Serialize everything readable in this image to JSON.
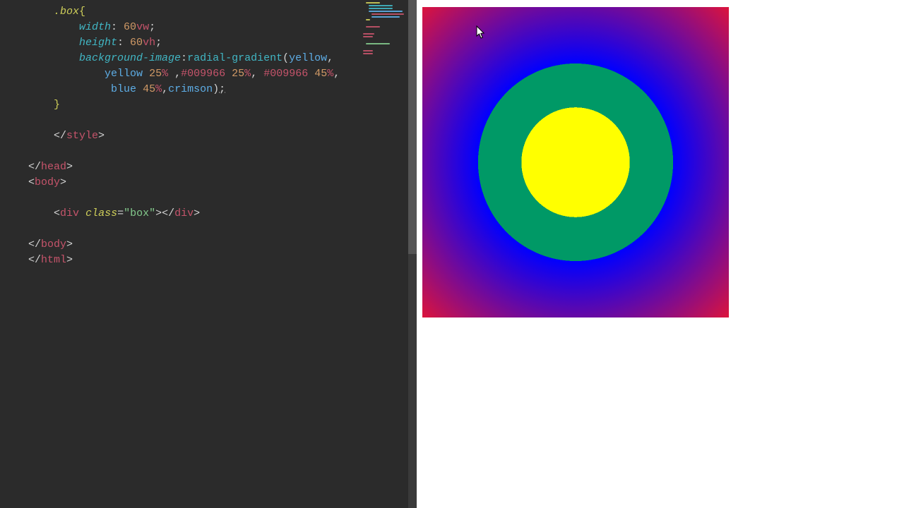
{
  "code": {
    "selector": ".box",
    "open_brace": "{",
    "width_prop": "width",
    "width_num": "60",
    "width_unit": "vw",
    "height_prop": "height",
    "height_num": "60",
    "height_unit": "vh",
    "bg_prop": "background-image",
    "fn_name": "radial-gradient",
    "c_yellow": "yellow",
    "p25": "25",
    "pct": "%",
    "c_green": "#009966",
    "p45": "45",
    "c_blue": "blue",
    "c_crimson": "crimson",
    "close_brace": "}",
    "end_style": "style",
    "end_head": "head",
    "body_tag": "body",
    "div_tag": "div",
    "class_attr": "class",
    "class_val": "\"box\"",
    "html_tag": "html"
  },
  "gradient": {
    "stops": "yellow, yellow 25%, #009966 25%, #009966 45%, blue 45%, crimson"
  }
}
